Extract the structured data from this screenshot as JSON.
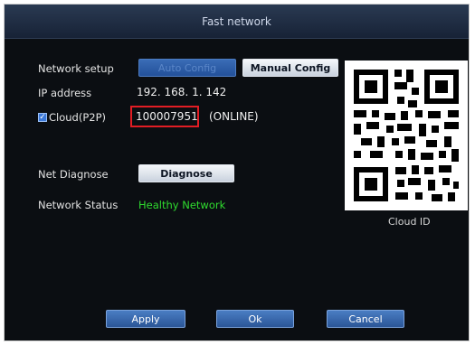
{
  "window": {
    "title": "Fast network"
  },
  "network_setup": {
    "label": "Network setup",
    "auto_config_label": "Auto Config",
    "manual_config_label": "Manual Config"
  },
  "ip": {
    "label": "IP address",
    "value": "192. 168. 1. 142"
  },
  "cloud": {
    "label": "Cloud(P2P)",
    "checked": true,
    "device_id": "100007951",
    "status": "(ONLINE)"
  },
  "diagnose": {
    "label": "Net Diagnose",
    "button_label": "Diagnose"
  },
  "network_status": {
    "label": "Network Status",
    "value": "Healthy Network"
  },
  "qr": {
    "caption": "Cloud ID",
    "icon": "qr-code-icon"
  },
  "footer": {
    "apply_label": "Apply",
    "ok_label": "Ok",
    "cancel_label": "Cancel"
  },
  "colors": {
    "background": "#0b0e12",
    "title_bar": "#1f2d44",
    "button_blue": "#2f5ea3",
    "status_green": "#2fdc2f",
    "highlight_red": "#e21d24"
  }
}
